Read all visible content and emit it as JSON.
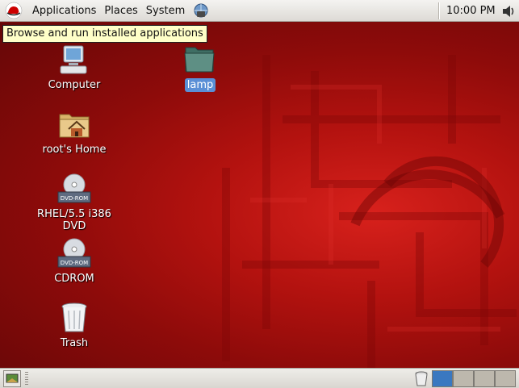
{
  "top_panel": {
    "menus": [
      "Applications",
      "Places",
      "System"
    ],
    "clock": "10:00 PM"
  },
  "tooltip": "Browse and run installed applications",
  "desktop_icons": [
    {
      "label": "Computer",
      "icon": "computer-icon"
    },
    {
      "label": "root's Home",
      "icon": "home-folder-icon"
    },
    {
      "label": "RHEL/5.5 i386 DVD",
      "icon": "dvd-icon"
    },
    {
      "label": "CDROM",
      "icon": "dvd-icon"
    },
    {
      "label": "Trash",
      "icon": "trash-icon"
    },
    {
      "label": "lamp",
      "icon": "folder-icon",
      "selected": true
    }
  ],
  "dvd_badge": "DVD-ROM",
  "bottom_panel": {
    "workspaces": 4,
    "active_workspace": 1
  },
  "colors": {
    "accent_selected": "#5a8fd6",
    "desktop_red": "#b3120f",
    "active_workspace": "#3a78c0"
  }
}
